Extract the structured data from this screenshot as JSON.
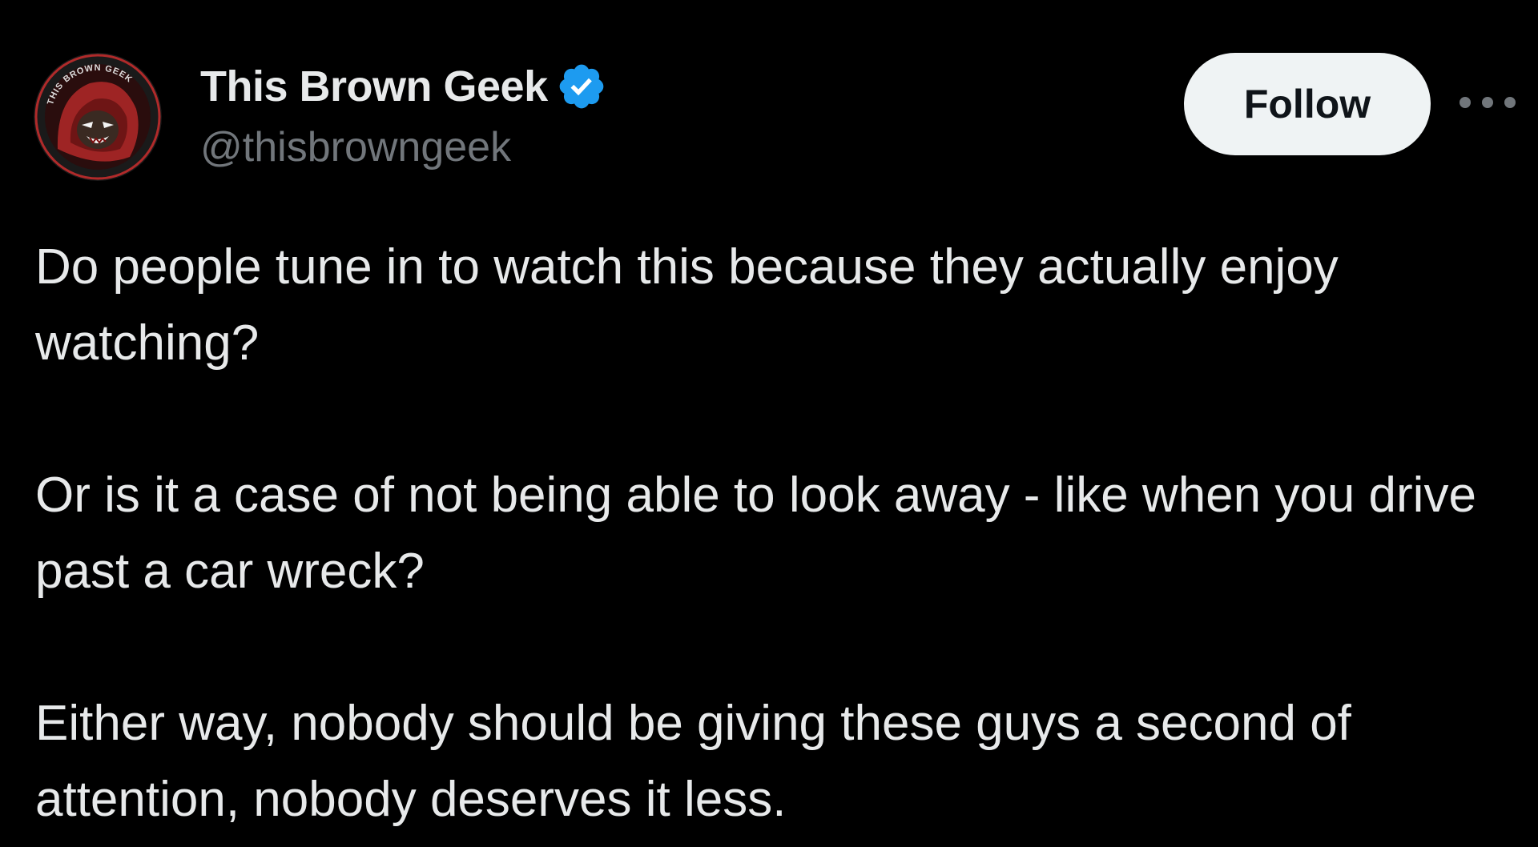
{
  "tweet": {
    "author": {
      "display_name": "This Brown Geek",
      "handle": "@thisbrowngeek",
      "verified_icon": "verified-badge-icon",
      "avatar_text": "THIS BROWN GEEK"
    },
    "follow_label": "Follow",
    "more_icon": "more-horizontal-icon",
    "paragraphs": [
      "Do people tune in to watch this because they actually enjoy watching?",
      "Or is it a case of not being able to look away - like when you drive past a car wreck?",
      "Either way, nobody should be giving these guys a second of attention, nobody deserves it less."
    ]
  },
  "colors": {
    "background": "#000000",
    "text_primary": "#e7e9ea",
    "text_secondary": "#71767b",
    "verified_blue": "#1d9bf0",
    "follow_bg": "#eff3f4",
    "follow_text": "#0f1419",
    "avatar_red": "#b02a2a"
  }
}
